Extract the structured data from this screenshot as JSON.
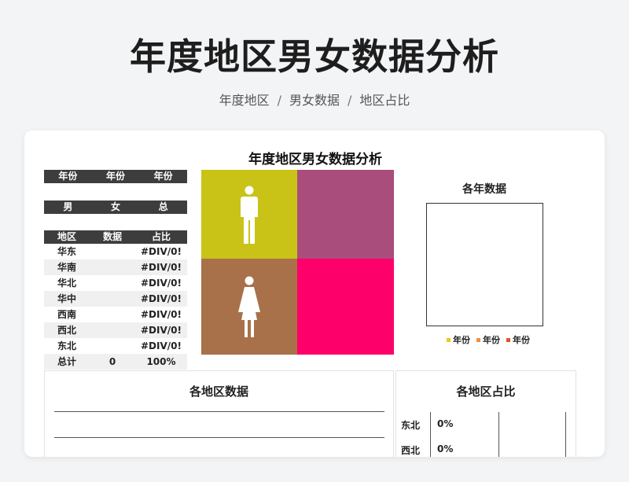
{
  "page": {
    "title": "年度地区男女数据分析",
    "breadcrumbs": [
      "年度地区",
      "男女数据",
      "地区占比"
    ]
  },
  "sheet": {
    "title": "年度地区男女数据分析",
    "year_headers": [
      "年份",
      "年份",
      "年份"
    ],
    "gender_headers": [
      "男",
      "女",
      "总"
    ],
    "table": {
      "columns": [
        "地区",
        "数据",
        "占比"
      ],
      "rows": [
        {
          "region": "华东",
          "value": "",
          "ratio": "#DIV/0!"
        },
        {
          "region": "华南",
          "value": "",
          "ratio": "#DIV/0!"
        },
        {
          "region": "华北",
          "value": "",
          "ratio": "#DIV/0!"
        },
        {
          "region": "华中",
          "value": "",
          "ratio": "#DIV/0!"
        },
        {
          "region": "西南",
          "value": "",
          "ratio": "#DIV/0!"
        },
        {
          "region": "西北",
          "value": "",
          "ratio": "#DIV/0!"
        },
        {
          "region": "东北",
          "value": "",
          "ratio": "#DIV/0!"
        }
      ],
      "total": {
        "label": "总计",
        "value": "0",
        "ratio": "100%"
      }
    },
    "quad_colors": [
      "#c9c318",
      "#a84d7c",
      "#a8714a",
      "#fe0069"
    ],
    "icons": [
      "male-figure-icon",
      "female-figure-icon"
    ],
    "year_chart": {
      "title": "各年数据",
      "legend": [
        {
          "label": "年份",
          "color": "#f5c31a"
        },
        {
          "label": "年份",
          "color": "#f0903a"
        },
        {
          "label": "年份",
          "color": "#e0542a"
        }
      ]
    },
    "region_data_panel": {
      "title": "各地区数据"
    },
    "region_ratio_panel": {
      "title": "各地区占比",
      "rows": [
        {
          "region": "东北",
          "ratio": "0%"
        },
        {
          "region": "西北",
          "ratio": "0%"
        }
      ]
    }
  }
}
